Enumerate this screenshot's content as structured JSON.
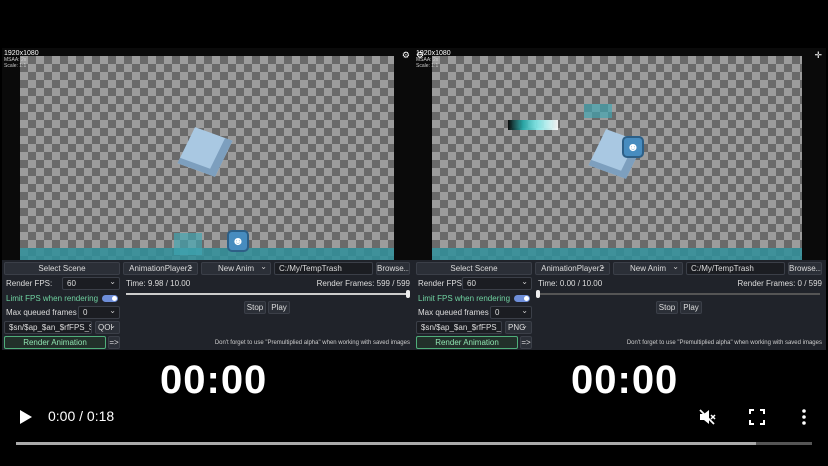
{
  "panes": [
    {
      "viewport": {
        "resolution": "1920x1080",
        "msaa": "MSAA: 2x",
        "scale": "Scale: 1:1"
      },
      "scene_button": "Select Scene",
      "player_select": "AnimationPlayer2",
      "anim_select": "New Anim",
      "path": "C:/My/TempTrash",
      "browse_button": "Browse...",
      "fps_label": "Render FPS:",
      "fps_value": "60",
      "time_text": "Time: 9.98 / 10.00",
      "frames_text": "Render Frames: 599 / 599",
      "progress": 1.0,
      "limit_fps_label": "Limit FPS when rendering",
      "limit_fps_enabled": true,
      "stop_button": "Stop",
      "play_button": "Play",
      "queued_label": "Max queued frames",
      "queued_value": "0",
      "filename_pattern": "$sn/$ap_$an_$rfFPS_$r",
      "format": "QOI",
      "render_button": "Render Animation",
      "more_button": "=>",
      "hint": "Don't forget to use \"Premultiplied alpha\" when working with saved images"
    },
    {
      "viewport": {
        "resolution": "1920x1080",
        "msaa": "MSAA: 2x",
        "scale": "Scale: 1:1"
      },
      "scene_button": "Select Scene",
      "player_select": "AnimationPlayer2",
      "anim_select": "New Anim",
      "path": "C:/My/TempTrash",
      "browse_button": "Browse...",
      "fps_label": "Render FPS:",
      "fps_value": "60",
      "time_text": "Time: 0.00 / 10.00",
      "frames_text": "Render Frames: 0 / 599",
      "progress": 0.0,
      "limit_fps_label": "Limit FPS when rendering",
      "limit_fps_enabled": true,
      "stop_button": "Stop",
      "play_button": "Play",
      "queued_label": "Max queued frames",
      "queued_value": "0",
      "filename_pattern": "$sn/$ap_$an_$rfFPS_$",
      "format": "PNG",
      "render_button": "Render Animation",
      "more_button": "=>",
      "hint": "Don't forget to use \"Premultiplied alpha\" when working with saved images"
    }
  ],
  "timers": [
    "00:00",
    "00:00"
  ],
  "video_player": {
    "time": "0:00 / 0:18",
    "progress": 0.0,
    "buffered": 0.93,
    "icons": [
      "play-icon",
      "mute-icon",
      "fullscreen-icon",
      "more-options-icon"
    ]
  },
  "colors": {
    "accent_green": "#6fd1a0",
    "toggle_blue": "#6e8ed9",
    "floor_teal": "#2f8f9a"
  }
}
